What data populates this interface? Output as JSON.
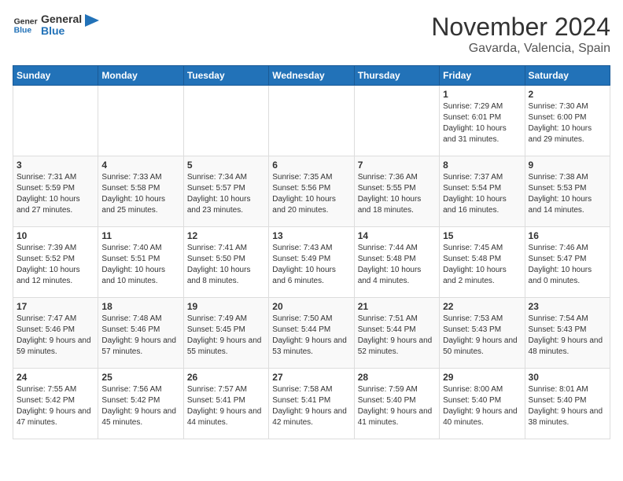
{
  "header": {
    "logo_general": "General",
    "logo_blue": "Blue",
    "month_title": "November 2024",
    "location": "Gavarda, Valencia, Spain"
  },
  "weekdays": [
    "Sunday",
    "Monday",
    "Tuesday",
    "Wednesday",
    "Thursday",
    "Friday",
    "Saturday"
  ],
  "weeks": [
    [
      {
        "day": "",
        "info": ""
      },
      {
        "day": "",
        "info": ""
      },
      {
        "day": "",
        "info": ""
      },
      {
        "day": "",
        "info": ""
      },
      {
        "day": "",
        "info": ""
      },
      {
        "day": "1",
        "info": "Sunrise: 7:29 AM\nSunset: 6:01 PM\nDaylight: 10 hours and 31 minutes."
      },
      {
        "day": "2",
        "info": "Sunrise: 7:30 AM\nSunset: 6:00 PM\nDaylight: 10 hours and 29 minutes."
      }
    ],
    [
      {
        "day": "3",
        "info": "Sunrise: 7:31 AM\nSunset: 5:59 PM\nDaylight: 10 hours and 27 minutes."
      },
      {
        "day": "4",
        "info": "Sunrise: 7:33 AM\nSunset: 5:58 PM\nDaylight: 10 hours and 25 minutes."
      },
      {
        "day": "5",
        "info": "Sunrise: 7:34 AM\nSunset: 5:57 PM\nDaylight: 10 hours and 23 minutes."
      },
      {
        "day": "6",
        "info": "Sunrise: 7:35 AM\nSunset: 5:56 PM\nDaylight: 10 hours and 20 minutes."
      },
      {
        "day": "7",
        "info": "Sunrise: 7:36 AM\nSunset: 5:55 PM\nDaylight: 10 hours and 18 minutes."
      },
      {
        "day": "8",
        "info": "Sunrise: 7:37 AM\nSunset: 5:54 PM\nDaylight: 10 hours and 16 minutes."
      },
      {
        "day": "9",
        "info": "Sunrise: 7:38 AM\nSunset: 5:53 PM\nDaylight: 10 hours and 14 minutes."
      }
    ],
    [
      {
        "day": "10",
        "info": "Sunrise: 7:39 AM\nSunset: 5:52 PM\nDaylight: 10 hours and 12 minutes."
      },
      {
        "day": "11",
        "info": "Sunrise: 7:40 AM\nSunset: 5:51 PM\nDaylight: 10 hours and 10 minutes."
      },
      {
        "day": "12",
        "info": "Sunrise: 7:41 AM\nSunset: 5:50 PM\nDaylight: 10 hours and 8 minutes."
      },
      {
        "day": "13",
        "info": "Sunrise: 7:43 AM\nSunset: 5:49 PM\nDaylight: 10 hours and 6 minutes."
      },
      {
        "day": "14",
        "info": "Sunrise: 7:44 AM\nSunset: 5:48 PM\nDaylight: 10 hours and 4 minutes."
      },
      {
        "day": "15",
        "info": "Sunrise: 7:45 AM\nSunset: 5:48 PM\nDaylight: 10 hours and 2 minutes."
      },
      {
        "day": "16",
        "info": "Sunrise: 7:46 AM\nSunset: 5:47 PM\nDaylight: 10 hours and 0 minutes."
      }
    ],
    [
      {
        "day": "17",
        "info": "Sunrise: 7:47 AM\nSunset: 5:46 PM\nDaylight: 9 hours and 59 minutes."
      },
      {
        "day": "18",
        "info": "Sunrise: 7:48 AM\nSunset: 5:46 PM\nDaylight: 9 hours and 57 minutes."
      },
      {
        "day": "19",
        "info": "Sunrise: 7:49 AM\nSunset: 5:45 PM\nDaylight: 9 hours and 55 minutes."
      },
      {
        "day": "20",
        "info": "Sunrise: 7:50 AM\nSunset: 5:44 PM\nDaylight: 9 hours and 53 minutes."
      },
      {
        "day": "21",
        "info": "Sunrise: 7:51 AM\nSunset: 5:44 PM\nDaylight: 9 hours and 52 minutes."
      },
      {
        "day": "22",
        "info": "Sunrise: 7:53 AM\nSunset: 5:43 PM\nDaylight: 9 hours and 50 minutes."
      },
      {
        "day": "23",
        "info": "Sunrise: 7:54 AM\nSunset: 5:43 PM\nDaylight: 9 hours and 48 minutes."
      }
    ],
    [
      {
        "day": "24",
        "info": "Sunrise: 7:55 AM\nSunset: 5:42 PM\nDaylight: 9 hours and 47 minutes."
      },
      {
        "day": "25",
        "info": "Sunrise: 7:56 AM\nSunset: 5:42 PM\nDaylight: 9 hours and 45 minutes."
      },
      {
        "day": "26",
        "info": "Sunrise: 7:57 AM\nSunset: 5:41 PM\nDaylight: 9 hours and 44 minutes."
      },
      {
        "day": "27",
        "info": "Sunrise: 7:58 AM\nSunset: 5:41 PM\nDaylight: 9 hours and 42 minutes."
      },
      {
        "day": "28",
        "info": "Sunrise: 7:59 AM\nSunset: 5:40 PM\nDaylight: 9 hours and 41 minutes."
      },
      {
        "day": "29",
        "info": "Sunrise: 8:00 AM\nSunset: 5:40 PM\nDaylight: 9 hours and 40 minutes."
      },
      {
        "day": "30",
        "info": "Sunrise: 8:01 AM\nSunset: 5:40 PM\nDaylight: 9 hours and 38 minutes."
      }
    ]
  ]
}
